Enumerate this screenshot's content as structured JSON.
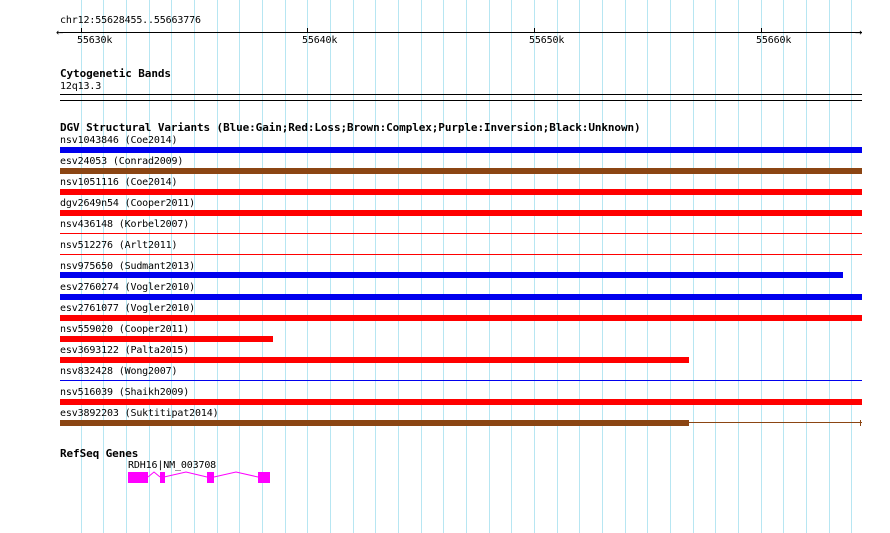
{
  "ruler": {
    "label": "chr12:55628455..55663776",
    "start_arrow": "←",
    "end_arrow": "→",
    "ticks": [
      {
        "label": "55630k"
      },
      {
        "label": "55640k"
      },
      {
        "label": "55650k"
      },
      {
        "label": "55660k"
      }
    ]
  },
  "cytogenetic": {
    "title": "Cytogenetic Bands",
    "band": "12q13.3"
  },
  "dgv": {
    "title": "DGV Structural Variants (Blue:Gain;Red:Loss;Brown:Complex;Purple:Inversion;Black:Unknown)",
    "colors": {
      "gain": "#0000ee",
      "loss": "#ff0000",
      "complex": "#8b4513"
    },
    "variants": [
      {
        "label": "nsv1043846 (Coe2014)",
        "type": "gain"
      },
      {
        "label": "esv24053 (Conrad2009)",
        "type": "complex"
      },
      {
        "label": "nsv1051116 (Coe2014)",
        "type": "loss"
      },
      {
        "label": "dgv2649n54 (Cooper2011)",
        "type": "loss"
      },
      {
        "label": "nsv436148 (Korbel2007)",
        "type": "loss"
      },
      {
        "label": "nsv512276 (Arlt2011)",
        "type": "loss"
      },
      {
        "label": "nsv975650 (Sudmant2013)",
        "type": "gain"
      },
      {
        "label": "esv2760274 (Vogler2010)",
        "type": "gain"
      },
      {
        "label": "esv2761077 (Vogler2010)",
        "type": "loss"
      },
      {
        "label": "nsv559020 (Cooper2011)",
        "type": "loss"
      },
      {
        "label": "esv3693122 (Palta2015)",
        "type": "loss"
      },
      {
        "label": "nsv832428 (Wong2007)",
        "type": "gain"
      },
      {
        "label": "nsv516039 (Shaikh2009)",
        "type": "loss"
      },
      {
        "label": "esv3892203 (Suktitipat2014)",
        "type": "complex"
      }
    ]
  },
  "refseq": {
    "title": "RefSeq Genes",
    "gene_label": "RDH16|NM_003708",
    "gene_color": "#ff00ff"
  }
}
